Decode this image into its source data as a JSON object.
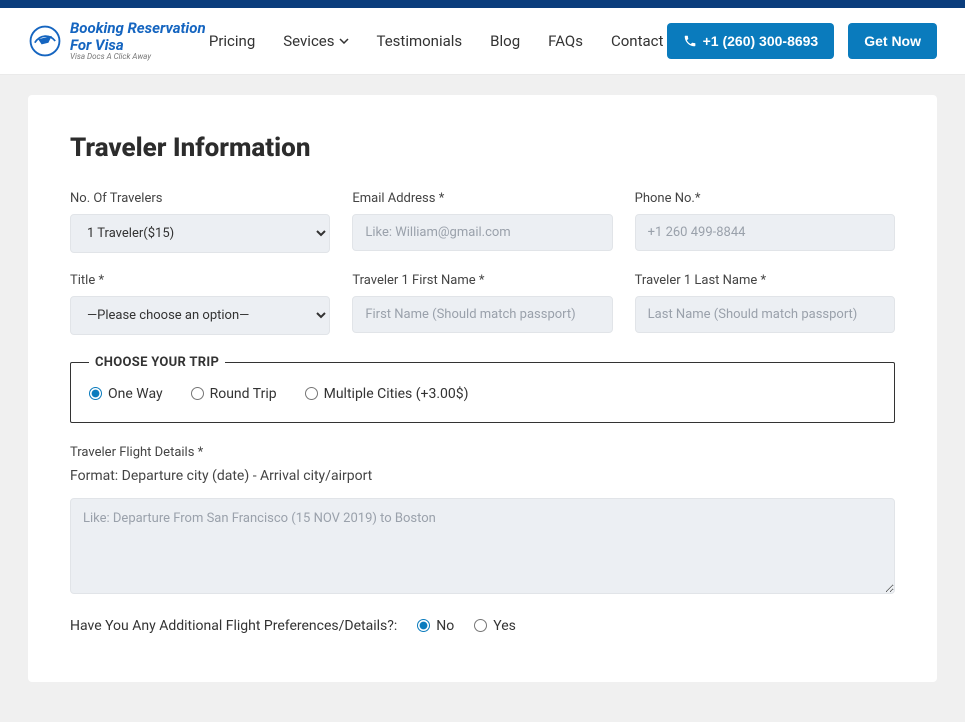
{
  "header": {
    "logo_line1": "Booking Reservation",
    "logo_line2": "For Visa",
    "logo_tag": "Visa Docs A Click Away",
    "nav": [
      "Pricing",
      "Sevices",
      "Testimonials",
      "Blog",
      "FAQs",
      "Contact"
    ],
    "phone": "+1 (260) 300-8693",
    "cta": "Get Now"
  },
  "form": {
    "title": "Traveler Information",
    "labels": {
      "travelers": "No. Of Travelers",
      "email": "Email Address *",
      "phone": "Phone No.*",
      "title": "Title *",
      "first": "Traveler 1 First Name *",
      "last": "Traveler 1 Last Name *",
      "trip_legend": "CHOOSE YOUR TRIP",
      "flight_details": "Traveler Flight Details *",
      "format_hint": "Format: Departure city (date) - Arrival city/airport",
      "pref_question": "Have You Any Additional Flight Preferences/Details?:",
      "no": "No",
      "yes": "Yes"
    },
    "placeholders": {
      "email": "Like: William@gmail.com",
      "phone": "+1 260 499-8844",
      "first": "First Name (Should match passport)",
      "last": "Last Name (Should match passport)",
      "details": "Like: Departure From San Francisco (15 NOV 2019) to Boston"
    },
    "selects": {
      "travelers_option": "1 Traveler($15)",
      "title_option": "—Please choose an option—"
    },
    "trip_options": {
      "one_way": "One Way",
      "round_trip": "Round Trip",
      "multi": "Multiple Cities (+3.00$)"
    }
  }
}
